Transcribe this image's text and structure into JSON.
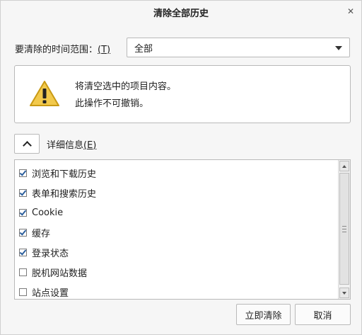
{
  "window": {
    "title": "清除全部历史"
  },
  "range": {
    "label": "要清除的时间范围：",
    "accesskey": "(T)",
    "selected": "全部"
  },
  "warning": {
    "line1": "将清空选中的项目内容。",
    "line2": "此操作不可撤销。"
  },
  "details": {
    "label": "详细信息",
    "accesskey": "(E)"
  },
  "items": [
    {
      "label": "浏览和下载历史",
      "checked": true
    },
    {
      "label": "表单和搜索历史",
      "checked": true
    },
    {
      "label": "Cookie",
      "checked": true
    },
    {
      "label": "缓存",
      "checked": true
    },
    {
      "label": "登录状态",
      "checked": true
    },
    {
      "label": "脱机网站数据",
      "checked": false
    },
    {
      "label": "站点设置",
      "checked": false
    }
  ],
  "buttons": {
    "clear": "立即清除",
    "cancel": "取消"
  },
  "colors": {
    "warning_fill": "#f2c94c",
    "warning_stroke": "#c99a14",
    "check": "#2b5e9c"
  }
}
